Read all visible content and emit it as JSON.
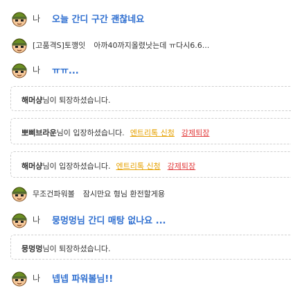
{
  "chat": {
    "me_label": "나",
    "m1": {
      "text": "오늘 간디 구간 괜찮네요"
    },
    "m2": {
      "user": "[고품격S]토깽잇",
      "text": "아까40까지올렸낫는데 ㅠ다시6.6..."
    },
    "m3": {
      "text": "ㅠㅠ..."
    },
    "s1": {
      "user": "해머샹",
      "suffix": "님이 퇴장하셨습니다."
    },
    "s2": {
      "user": "뽀삐브라운",
      "suffix": "님이 입장하셨습니다.",
      "entry_button": "엔트리톡 신청",
      "kick_button": "강제퇴장"
    },
    "s3": {
      "user": "해머샹",
      "suffix": "님이 입장하셨습니다.",
      "entry_button": "엔트리톡 신청",
      "kick_button": "강제퇴장"
    },
    "m4": {
      "user": "무조건파워볼",
      "text": "잠시만요 형님 환전할게용"
    },
    "m5": {
      "text": "뭉멍멍님 간디 매탕 없나요 ..."
    },
    "s4": {
      "user": "뭉멍멍",
      "suffix": "님이 퇴장하셨습니다."
    },
    "m6": {
      "text": "넵넵 파워볼님!!"
    }
  },
  "icons": {
    "avatar": "soldier-avatar-icon"
  },
  "colors": {
    "my_message": "#2f6fd0",
    "entry_link": "#e6a100",
    "kick_link": "#e23d3d",
    "dashed_border": "#cfcfcf"
  }
}
